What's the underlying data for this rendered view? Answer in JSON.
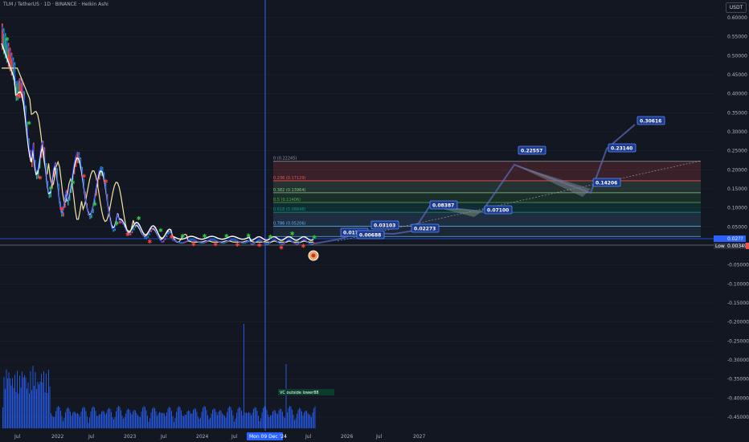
{
  "header": {
    "title": "TLM / TetherUS · 1D · BINANCE · Heikin Ashi",
    "currency": "USDT"
  },
  "colors": {
    "bg": "#131722",
    "bull": "#26a69a",
    "bear": "#ef5350",
    "accent": "#2962ff",
    "ma": "#f5e6a3",
    "price_line": "#2962ff"
  },
  "chart_data": {
    "type": "line",
    "ylim": [
      -0.48,
      0.62
    ],
    "y_ticks": [
      "0.60000",
      "0.55000",
      "0.50000",
      "0.45000",
      "0.40000",
      "0.35000",
      "0.30000",
      "0.25000",
      "0.20000",
      "0.15000",
      "0.10000",
      "0.05000",
      "-0.05000",
      "-0.10000",
      "-0.15000",
      "-0.20000",
      "-0.25000",
      "-0.30000",
      "-0.35000",
      "-0.40000",
      "-0.45000"
    ],
    "x_ticks": [
      "Jul",
      "2022",
      "Jul",
      "2023",
      "Jul",
      "2024",
      "Jul",
      "Mon 09 Dec '24",
      "Jul",
      "2026",
      "Jul",
      "2027"
    ],
    "fib_levels": [
      {
        "label": "0 (0.22245)",
        "value": 0.22245,
        "color": "#9598a1"
      },
      {
        "label": "0.236 (0.17129)",
        "value": 0.17129,
        "color": "#ef5350"
      },
      {
        "label": "0.382 (0.13964)",
        "value": 0.13964,
        "color": "#81c784"
      },
      {
        "label": "0.5 (0.11406)",
        "value": 0.11406,
        "color": "#4caf50"
      },
      {
        "label": "0.618 (0.08848)",
        "value": 0.08848,
        "color": "#089981"
      },
      {
        "label": "0.786 (0.05206)",
        "value": 0.05206,
        "color": "#64b5f6"
      }
    ],
    "targets": [
      "0.01??",
      "0.00688",
      "0.03103",
      "0.02273",
      "0.08387",
      "0.07100",
      "0.22557",
      "0.14206",
      "0.23140",
      "0.30616"
    ],
    "price_labels": {
      "current": "0.02??",
      "low_label": "Low",
      "low_value": "0.00349"
    },
    "indicator_label": "VC outside lower88"
  }
}
